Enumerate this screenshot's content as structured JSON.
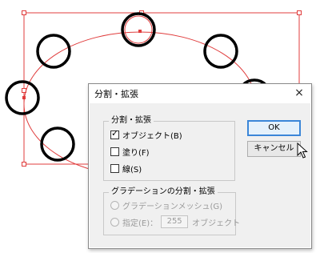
{
  "dialog": {
    "title": "分割・拡張",
    "close_glyph": "×",
    "expand_group": {
      "legend": "分割・拡張",
      "options": [
        {
          "label": "オブジェクト(B)",
          "checked": true
        },
        {
          "label": "塗り(F)",
          "checked": false
        },
        {
          "label": "線(S)",
          "checked": false
        }
      ]
    },
    "gradient_group": {
      "legend": "グラデーションの分割・拡張",
      "mesh_label": "グラデーションメッシュ(G)",
      "specify_label": "指定(E)：",
      "specify_value": "255",
      "specify_unit": "オブジェクト"
    },
    "ok_label": "OK",
    "cancel_label": "キャンセル",
    "checkmark": "✓"
  },
  "colors": {
    "selection_red": "#e03c3c",
    "circle_stroke": "#000000",
    "ok_border": "#3b86d8"
  },
  "icons": [
    "close-icon",
    "checkbox-icon",
    "radio-icon",
    "mouse-pointer-icon",
    "anchor-point-icon"
  ]
}
